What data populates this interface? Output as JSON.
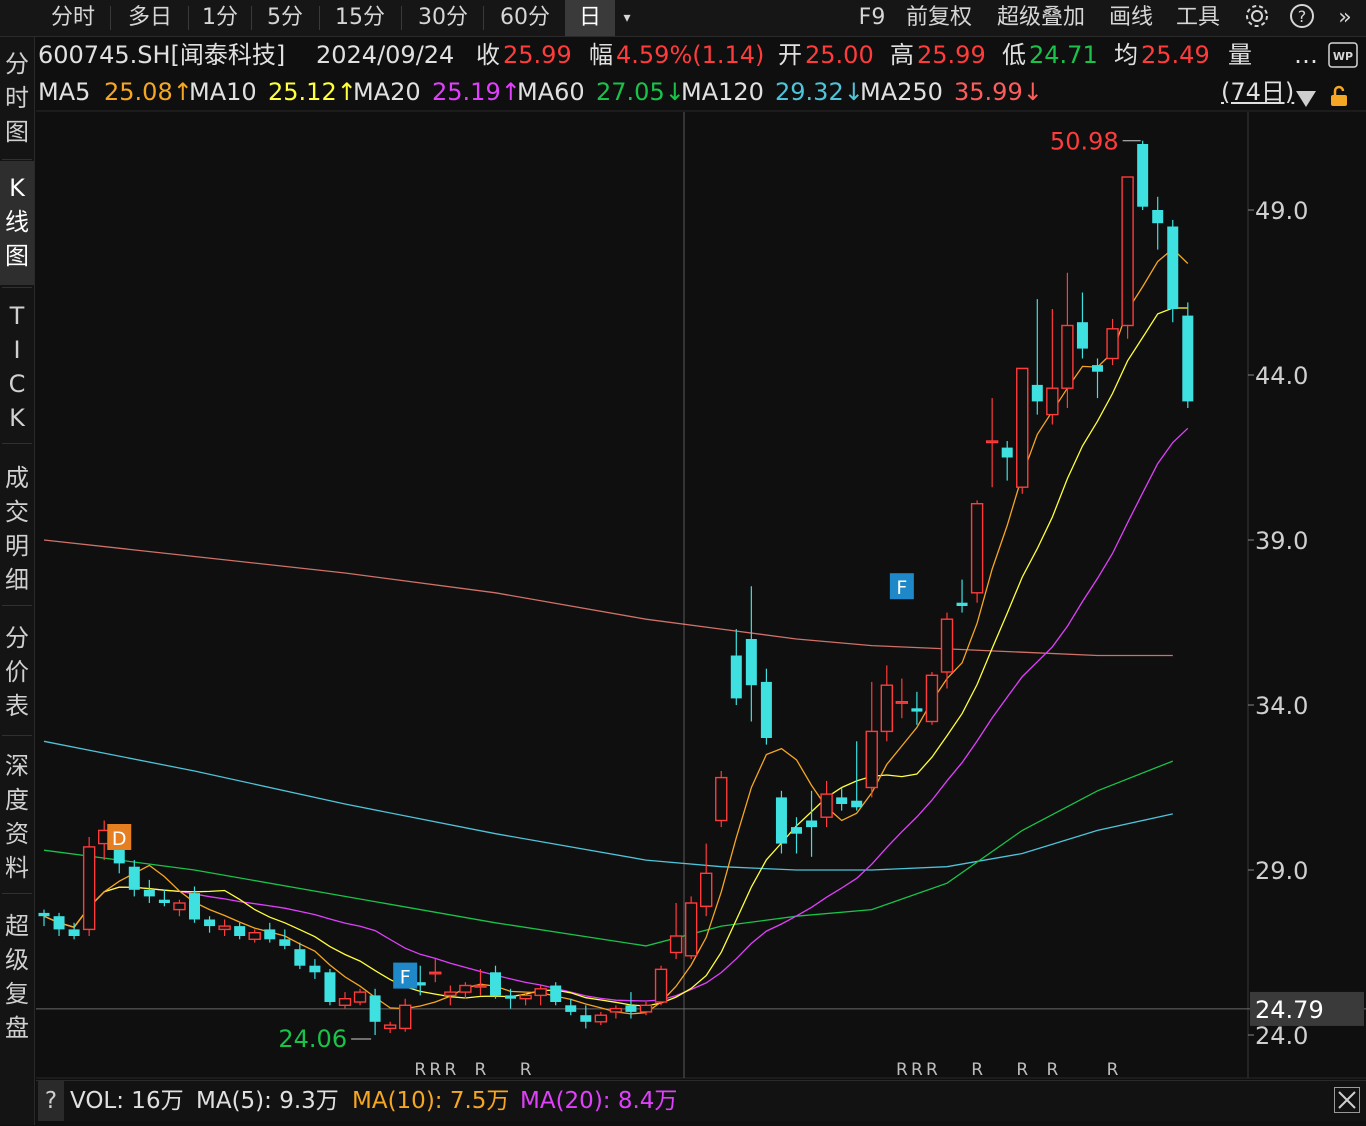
{
  "toolbar": {
    "items": [
      "分时",
      "多日",
      "1分",
      "5分",
      "15分",
      "30分",
      "60分",
      "日"
    ],
    "active_index": 7,
    "dropdown_icon": "caret-down-icon",
    "right_items": [
      "F9",
      "前复权",
      "超级叠加",
      "画线",
      "工具"
    ],
    "right_icons": [
      "gear-icon",
      "help-icon",
      "chevron-double-right-icon"
    ]
  },
  "left_tabs": [
    "分时图",
    "K线图",
    "TICK",
    "成交明细",
    "分价表",
    "深度资料",
    "超级复盘"
  ],
  "left_tab_active": 1,
  "info": {
    "symbol": "600745.SH[闻泰科技]",
    "date": "2024/09/24",
    "close_label": "收",
    "close": "25.99",
    "change_label": "幅",
    "change": "4.59%(1.14)",
    "open_label": "开",
    "open": "25.00",
    "high_label": "高",
    "high": "25.99",
    "low_label": "低",
    "low": "24.71",
    "avg_label": "均",
    "avg": "25.49",
    "vol_label": "量",
    "more": "…",
    "wp_icon": "wp-icon"
  },
  "ma_bar": {
    "items": [
      {
        "label": "MA5",
        "value": "25.08↑",
        "color": "#f5a623"
      },
      {
        "label": "MA10",
        "value": "25.12↑",
        "color": "#ffff3c"
      },
      {
        "label": "MA20",
        "value": "25.19↑",
        "color": "#e040fb"
      },
      {
        "label": "MA60",
        "value": "27.05↓",
        "color": "#19c34a"
      },
      {
        "label": "MA120",
        "value": "29.32↓",
        "color": "#4fc3d9"
      },
      {
        "label": "MA250",
        "value": "35.99↓",
        "color": "#ff5c5c"
      }
    ],
    "days": "(74日)",
    "lock_icon": "lock-icon"
  },
  "chart_data": {
    "type": "candlestick",
    "y_ticks": [
      "24.0",
      "29.0",
      "34.0",
      "39.0",
      "44.0",
      "49.0"
    ],
    "ylim": [
      23.0,
      51.5
    ],
    "price_line": "24.79",
    "high_marker": "50.98",
    "low_marker": "24.06",
    "markers": [
      {
        "text": "D",
        "index": 5,
        "price": 30.0,
        "color": "#e67e22"
      },
      {
        "text": "F",
        "index": 24,
        "price": 25.8,
        "color": "#1e88c8"
      },
      {
        "text": "F",
        "index": 57,
        "price": 37.6,
        "color": "#1e88c8"
      }
    ],
    "r_labels": {
      "text": "R",
      "indices": [
        25,
        26,
        27,
        29,
        32,
        57,
        58,
        59,
        62,
        65,
        67,
        71
      ]
    },
    "candles": [
      [
        27.7,
        27.8,
        27.3,
        27.6
      ],
      [
        27.6,
        27.7,
        27.0,
        27.2
      ],
      [
        27.2,
        27.4,
        26.9,
        27.0
      ],
      [
        27.2,
        30.0,
        27.0,
        29.7
      ],
      [
        29.8,
        30.5,
        29.3,
        30.2
      ],
      [
        29.8,
        30.3,
        28.9,
        29.2
      ],
      [
        29.1,
        29.3,
        28.2,
        28.4
      ],
      [
        28.4,
        28.7,
        28.0,
        28.2
      ],
      [
        28.1,
        28.4,
        27.9,
        28.0
      ],
      [
        27.8,
        28.1,
        27.6,
        28.0
      ],
      [
        28.3,
        28.5,
        27.4,
        27.5
      ],
      [
        27.5,
        27.6,
        27.1,
        27.3
      ],
      [
        27.2,
        27.5,
        27.0,
        27.3
      ],
      [
        27.3,
        27.4,
        26.9,
        27.0
      ],
      [
        26.9,
        27.2,
        26.8,
        27.1
      ],
      [
        27.2,
        27.4,
        26.8,
        26.9
      ],
      [
        26.9,
        27.2,
        26.6,
        26.7
      ],
      [
        26.6,
        26.8,
        26.0,
        26.1
      ],
      [
        26.1,
        26.3,
        25.7,
        25.9
      ],
      [
        25.9,
        26.0,
        24.9,
        25.0
      ],
      [
        24.9,
        25.3,
        24.8,
        25.1
      ],
      [
        25.0,
        25.4,
        24.9,
        25.3
      ],
      [
        25.2,
        25.4,
        24.0,
        24.4
      ],
      [
        24.2,
        24.4,
        24.06,
        24.3
      ],
      [
        24.2,
        25.1,
        24.1,
        24.9
      ],
      [
        25.6,
        26.1,
        25.2,
        25.5
      ],
      [
        25.9,
        26.3,
        25.6,
        25.9
      ],
      [
        25.2,
        25.5,
        24.9,
        25.3
      ],
      [
        25.3,
        25.6,
        25.1,
        25.5
      ],
      [
        25.5,
        26.0,
        25.2,
        25.5
      ],
      [
        25.9,
        26.1,
        25.1,
        25.2
      ],
      [
        25.2,
        25.4,
        24.8,
        25.1
      ],
      [
        25.1,
        25.3,
        24.9,
        25.2
      ],
      [
        25.2,
        25.5,
        24.9,
        25.4
      ],
      [
        25.5,
        25.6,
        24.9,
        25.0
      ],
      [
        24.9,
        25.1,
        24.6,
        24.7
      ],
      [
        24.6,
        24.9,
        24.2,
        24.4
      ],
      [
        24.4,
        24.7,
        24.3,
        24.6
      ],
      [
        24.7,
        24.9,
        24.5,
        24.8
      ],
      [
        24.9,
        25.3,
        24.5,
        24.7
      ],
      [
        24.7,
        25.0,
        24.6,
        24.9
      ],
      [
        25.0,
        26.1,
        24.9,
        25.99
      ],
      [
        26.5,
        28.0,
        26.3,
        27.0
      ],
      [
        26.4,
        28.2,
        26.3,
        28.0
      ],
      [
        27.9,
        29.8,
        27.6,
        28.9
      ],
      [
        30.5,
        32.0,
        30.3,
        31.8
      ],
      [
        35.5,
        36.3,
        34.0,
        34.2
      ],
      [
        36.0,
        37.6,
        33.5,
        34.6
      ],
      [
        34.7,
        35.1,
        32.8,
        33.0
      ],
      [
        31.2,
        31.4,
        29.5,
        29.8
      ],
      [
        30.3,
        30.6,
        29.5,
        30.1
      ],
      [
        30.5,
        31.4,
        29.4,
        30.3
      ],
      [
        30.6,
        31.7,
        30.3,
        31.3
      ],
      [
        31.2,
        31.5,
        30.8,
        31.0
      ],
      [
        31.1,
        32.9,
        30.8,
        30.9
      ],
      [
        31.5,
        34.7,
        31.2,
        33.2
      ],
      [
        33.2,
        35.2,
        32.9,
        34.6
      ],
      [
        34.1,
        34.8,
        33.6,
        34.1
      ],
      [
        33.9,
        34.4,
        33.4,
        33.8
      ],
      [
        33.5,
        35.0,
        33.4,
        34.9
      ],
      [
        35.0,
        36.8,
        34.5,
        36.6
      ],
      [
        37.1,
        37.8,
        36.8,
        37.0
      ],
      [
        37.4,
        40.2,
        37.1,
        40.1
      ],
      [
        42.0,
        43.3,
        40.6,
        42.0
      ],
      [
        41.8,
        42.0,
        40.8,
        41.5
      ],
      [
        40.6,
        44.1,
        40.4,
        44.2
      ],
      [
        43.7,
        46.3,
        42.8,
        43.2
      ],
      [
        42.8,
        46.0,
        42.5,
        43.6
      ],
      [
        43.6,
        47.1,
        43.0,
        45.5
      ],
      [
        45.6,
        46.5,
        44.5,
        44.8
      ],
      [
        44.3,
        44.5,
        43.3,
        44.1
      ],
      [
        44.5,
        45.7,
        44.3,
        45.4
      ],
      [
        45.5,
        49.1,
        45.1,
        50.0
      ],
      [
        51.0,
        51.1,
        49.0,
        49.1
      ],
      [
        49.0,
        49.4,
        47.8,
        48.6
      ],
      [
        48.5,
        48.7,
        45.6,
        46.0
      ],
      [
        45.8,
        46.2,
        43.0,
        43.2
      ]
    ],
    "ma_colors": {
      "ma5": "#f5a623",
      "ma10": "#ffff3c",
      "ma20": "#e040fb",
      "ma60": "#19c34a",
      "ma120": "#4fc3d9",
      "ma250": "#ff8a80"
    },
    "ma60_points": [
      [
        0,
        29.6
      ],
      [
        10,
        29.0
      ],
      [
        20,
        28.2
      ],
      [
        30,
        27.4
      ],
      [
        40,
        26.7
      ],
      [
        45,
        27.3
      ],
      [
        50,
        27.6
      ],
      [
        55,
        27.8
      ],
      [
        60,
        28.6
      ],
      [
        65,
        30.2
      ],
      [
        70,
        31.4
      ],
      [
        75,
        32.3
      ]
    ],
    "ma120_points": [
      [
        0,
        32.9
      ],
      [
        10,
        32.0
      ],
      [
        20,
        31.0
      ],
      [
        30,
        30.1
      ],
      [
        40,
        29.3
      ],
      [
        45,
        29.1
      ],
      [
        50,
        29.0
      ],
      [
        55,
        29.0
      ],
      [
        60,
        29.1
      ],
      [
        65,
        29.5
      ],
      [
        70,
        30.2
      ],
      [
        75,
        30.7
      ]
    ],
    "ma250_points": [
      [
        0,
        39.0
      ],
      [
        10,
        38.5
      ],
      [
        20,
        38.0
      ],
      [
        30,
        37.4
      ],
      [
        40,
        36.6
      ],
      [
        45,
        36.3
      ],
      [
        50,
        36.0
      ],
      [
        55,
        35.8
      ],
      [
        60,
        35.7
      ],
      [
        65,
        35.6
      ],
      [
        70,
        35.5
      ],
      [
        75,
        35.5
      ]
    ]
  },
  "vol_bar": {
    "help_icon": "question-icon",
    "vol": "VOL: 16万",
    "ma5": "MA(5): 9.3万",
    "ma10": "MA(10): 7.5万",
    "ma20": "MA(20): 8.4万",
    "colors": {
      "vol": "#e0e0e0",
      "ma5": "#e0e0e0",
      "ma10": "#f5a623",
      "ma20": "#e040fb"
    },
    "close_icon": "close-icon"
  }
}
